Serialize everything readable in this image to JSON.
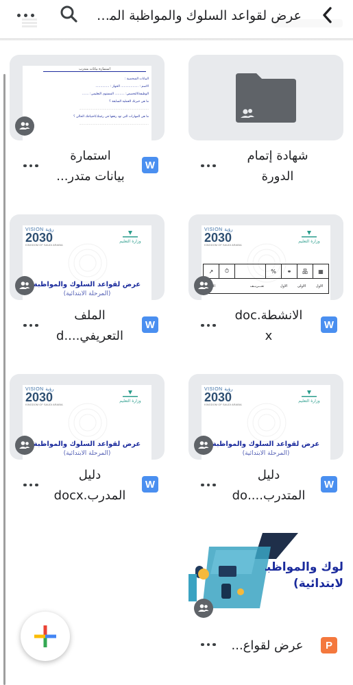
{
  "header": {
    "title": "عرض لقواعد السلوك والمواظبة المر...",
    "back_icon": "chevron-left-icon",
    "search_icon": "search-icon",
    "more_icon": "more-vert-icon"
  },
  "files": [
    {
      "name_line1": "شهادة إتمام",
      "name_line2": "الدورة",
      "kind": "folder",
      "shared": true
    },
    {
      "name_line1": "استمارة",
      "name_line2": "بيانات متدر...",
      "kind": "word",
      "type_badge": "W",
      "shared": true,
      "thumb": {
        "heading": "استمارة بيانات متدرب",
        "lines": [
          "البيانات الشخصية :",
          "الاسم : .................. الجهاز : ..............",
          "الوظيفة/التخصص: .......... المستوى التعليمي: .......",
          "ما هي خبرتك العملية السابقة ؟",
          "ما هي المهارات التي تود رفعها في رغبتك/احتياجك الحالي ؟"
        ]
      }
    },
    {
      "name_line1": "الانشطة.doc",
      "name_line2": "x",
      "kind": "word",
      "type_badge": "W",
      "shared": true,
      "thumb": {
        "vision": "VISION",
        "vision_arabic": "رؤية",
        "vision_year": "2030",
        "moe": "وزارة التعليم",
        "table_head": [
          "الأول",
          "الأولى",
          "الأول",
          "تعــريف",
          "بعد"
        ],
        "table_sub": [
          "الاول",
          "الاولى",
          "الاول",
          "تعـــريــف",
          "ddl"
        ]
      }
    },
    {
      "name_line1": "الملف",
      "name_line2": "التعريفي....d",
      "kind": "word",
      "type_badge": "W",
      "shared": true,
      "thumb": {
        "vision": "VISION",
        "vision_arabic": "رؤية",
        "vision_year": "2030",
        "moe": "وزارة التعليم",
        "title": "عرض لقواعد السلوك والمواظبة",
        "subtitle": "(المرحلة الابتدائية)"
      }
    },
    {
      "name_line1": "دليل",
      "name_line2": "المتدرب....do",
      "kind": "word",
      "type_badge": "W",
      "shared": true,
      "thumb": {
        "vision": "VISION",
        "vision_arabic": "رؤية",
        "vision_year": "2030",
        "moe": "وزارة التعليم",
        "title": "عرض لقواعد السلوك والمواظبة",
        "subtitle": "(المرحلة الابتدائية)"
      }
    },
    {
      "name_line1": "دليل",
      "name_line2": "المدرب.docx",
      "kind": "word",
      "type_badge": "W",
      "shared": true,
      "thumb": {
        "vision": "VISION",
        "vision_arabic": "رؤية",
        "vision_year": "2030",
        "moe": "وزارة التعليم",
        "title": "عرض لقواعد السلوك والمواظبة",
        "subtitle": "(المرحلة الابتدائية)"
      }
    },
    {
      "name_line1": "عرض لقواع...",
      "kind": "powerpoint",
      "type_badge": "P",
      "shared": true,
      "thumb": {
        "title": "لوك والمواظبة",
        "subtitle": "لابتدائية)"
      }
    }
  ],
  "fab": {
    "icon": "plus-icon"
  },
  "colors": {
    "word": "#4a8ff0",
    "powerpoint": "#f4783d",
    "folder": "#5f6368",
    "card_bg": "#e8eaed",
    "doc_title": "#1a2a9c"
  }
}
